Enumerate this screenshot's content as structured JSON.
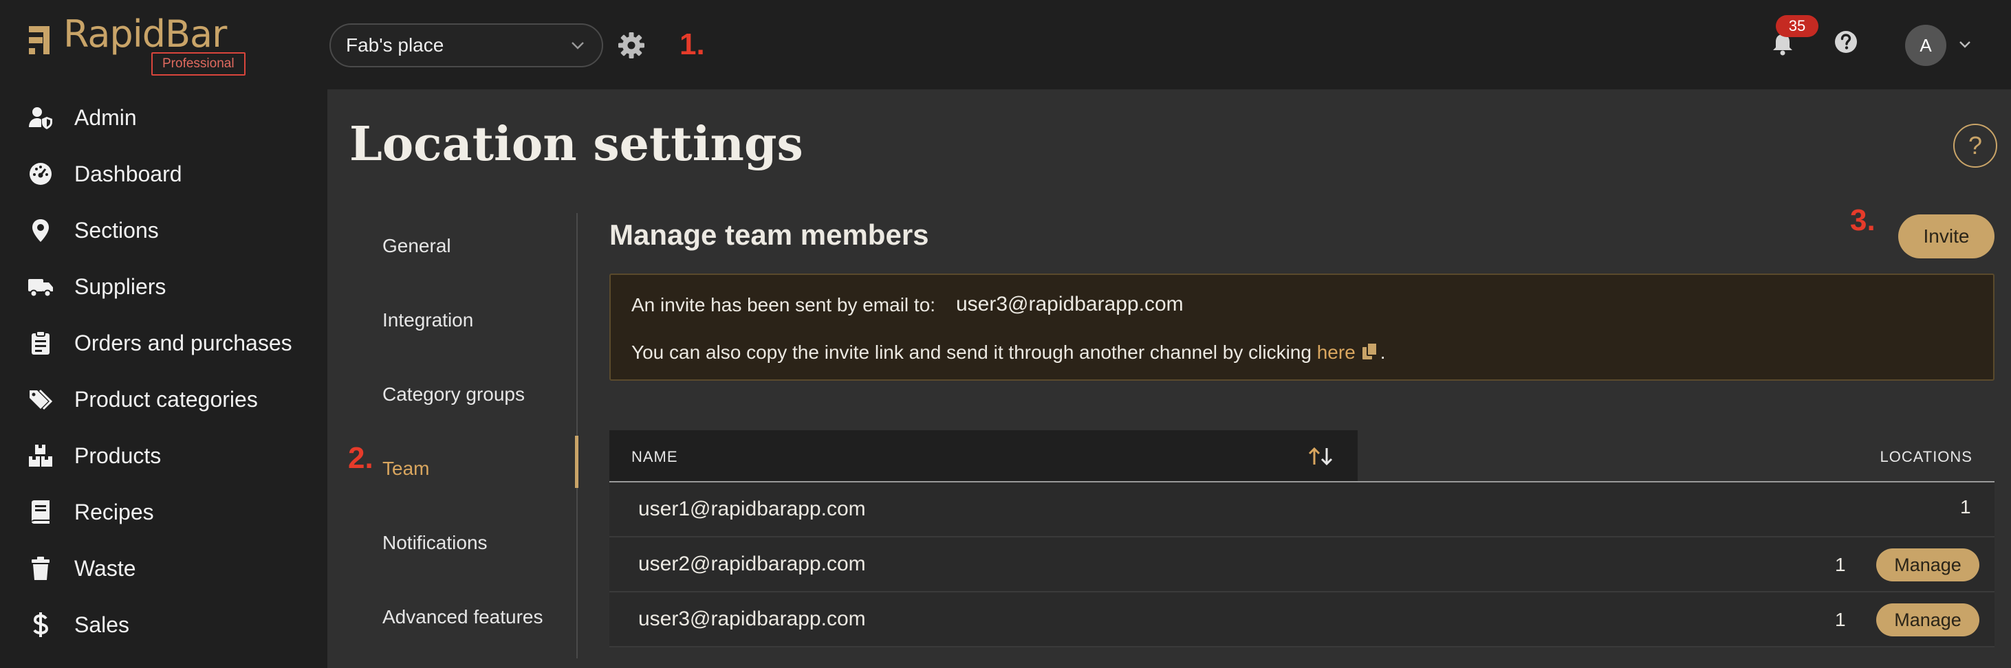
{
  "brand": {
    "name": "RapidBar",
    "plan_badge": "Professional",
    "accent_color": "#c9a468",
    "badge_color": "#d9453c"
  },
  "header": {
    "location_select": {
      "value": "Fab's place"
    },
    "settings_icon": "gear-icon",
    "notifications": {
      "icon": "bell-icon",
      "count": "35"
    },
    "help_icon": "question-icon",
    "user_avatar": {
      "initial": "A"
    }
  },
  "annotations": {
    "step1": "1.",
    "step2": "2.",
    "step3": "3."
  },
  "sidebar": {
    "items": [
      {
        "label": "Admin",
        "icon": "user-shield-icon"
      },
      {
        "label": "Dashboard",
        "icon": "gauge-icon"
      },
      {
        "label": "Sections",
        "icon": "map-pin-icon"
      },
      {
        "label": "Suppliers",
        "icon": "truck-icon"
      },
      {
        "label": "Orders and purchases",
        "icon": "clipboard-icon"
      },
      {
        "label": "Product categories",
        "icon": "tags-icon"
      },
      {
        "label": "Products",
        "icon": "boxes-icon"
      },
      {
        "label": "Recipes",
        "icon": "book-icon"
      },
      {
        "label": "Waste",
        "icon": "trash-icon"
      },
      {
        "label": "Sales",
        "icon": "dollar-icon"
      }
    ]
  },
  "page": {
    "title": "Location settings",
    "help_icon": "question-circle-icon"
  },
  "settings_nav": {
    "items": [
      {
        "label": "General"
      },
      {
        "label": "Integration"
      },
      {
        "label": "Category groups"
      },
      {
        "label": "Team",
        "active": true
      },
      {
        "label": "Notifications"
      },
      {
        "label": "Advanced features"
      }
    ]
  },
  "team": {
    "title": "Manage team members",
    "invite_button": "Invite",
    "notice": {
      "line1_prefix": "An invite has been sent by email to:",
      "email": "user3@rapidbarapp.com",
      "line2_prefix": "You can also copy the invite link and send it through another channel by clicking",
      "link_text": "here",
      "line2_suffix": "."
    },
    "table": {
      "columns": {
        "name": "NAME",
        "locations": "LOCATIONS"
      },
      "rows": [
        {
          "email": "user1@rapidbarapp.com",
          "locations": "1",
          "manage": ""
        },
        {
          "email": "user2@rapidbarapp.com",
          "locations": "1",
          "manage": "Manage"
        },
        {
          "email": "user3@rapidbarapp.com",
          "locations": "1",
          "manage": "Manage"
        }
      ]
    }
  }
}
